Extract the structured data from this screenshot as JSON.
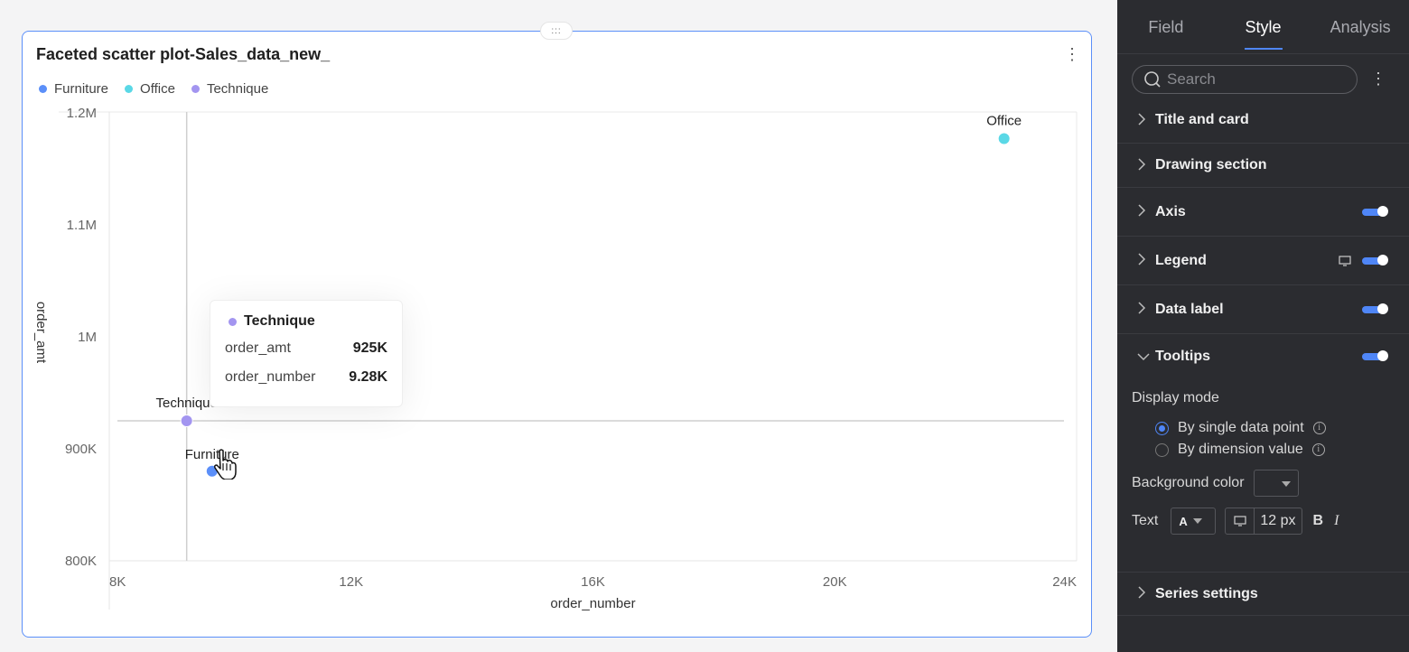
{
  "card": {
    "title": "Faceted scatter plot-Sales_data_new_",
    "drag_handle": ":::",
    "menu": "⋮"
  },
  "legend": [
    {
      "label": "Furniture",
      "color": "#5b8ff9"
    },
    {
      "label": "Office",
      "color": "#5ad8e6"
    },
    {
      "label": "Technique",
      "color": "#a395f0"
    }
  ],
  "chart_data": {
    "type": "scatter",
    "title": "Faceted scatter plot-Sales_data_new_",
    "xlabel": "order_number",
    "ylabel": "order_amt",
    "xlim": [
      8000,
      24000
    ],
    "ylim": [
      800000,
      1200000
    ],
    "x_ticks": [
      "8K",
      "12K",
      "16K",
      "20K",
      "24K"
    ],
    "x_tick_values": [
      8000,
      12000,
      16000,
      20000,
      24000
    ],
    "y_ticks": [
      "800K",
      "900K",
      "1M",
      "1.1M",
      "1.2M"
    ],
    "y_tick_values": [
      800000,
      900000,
      1000000,
      1100000,
      1200000
    ],
    "grid": false,
    "legend_position": "top-left",
    "series": [
      {
        "name": "Furniture",
        "color": "#5b8ff9",
        "points": [
          {
            "x": 9700,
            "y": 880000,
            "label": "Furniture"
          }
        ]
      },
      {
        "name": "Office",
        "color": "#5ad8e6",
        "points": [
          {
            "x": 22800,
            "y": 1177000,
            "label": "Office"
          }
        ]
      },
      {
        "name": "Technique",
        "color": "#a395f0",
        "points": [
          {
            "x": 9280,
            "y": 925000,
            "label": "Technique"
          }
        ]
      }
    ],
    "crosshair": {
      "x": 9280,
      "y": 925000
    }
  },
  "tooltip": {
    "series": "Technique",
    "color": "#a395f0",
    "rows": [
      {
        "label": "order_amt",
        "value": "925K"
      },
      {
        "label": "order_number",
        "value": "9.28K"
      }
    ]
  },
  "panel": {
    "tabs": [
      {
        "label": "Field",
        "active": false
      },
      {
        "label": "Style",
        "active": true
      },
      {
        "label": "Analysis",
        "active": false
      }
    ],
    "search": {
      "placeholder": "Search",
      "value": ""
    },
    "menu": "⋮",
    "sections": {
      "title_card": {
        "label": "Title and card"
      },
      "drawing": {
        "label": "Drawing section"
      },
      "axis": {
        "label": "Axis",
        "enabled": true
      },
      "legend": {
        "label": "Legend",
        "enabled": true
      },
      "data_label": {
        "label": "Data label",
        "enabled": true
      },
      "tooltips": {
        "label": "Tooltips",
        "enabled": true,
        "expanded": true
      },
      "series": {
        "label": "Series settings"
      }
    },
    "tooltips_settings": {
      "display_mode_label": "Display mode",
      "options": [
        {
          "label": "By single data point",
          "checked": true
        },
        {
          "label": "By dimension value",
          "checked": false
        }
      ],
      "background_color_label": "Background color",
      "text_label": "Text",
      "font_color_glyph": "A",
      "font_size": "12",
      "font_unit": "px",
      "bold": "B",
      "italic": "I"
    }
  },
  "colors": {
    "accent": "#4f86f7",
    "panel_bg": "#2b2c30",
    "card_border": "#5b8ff9"
  }
}
